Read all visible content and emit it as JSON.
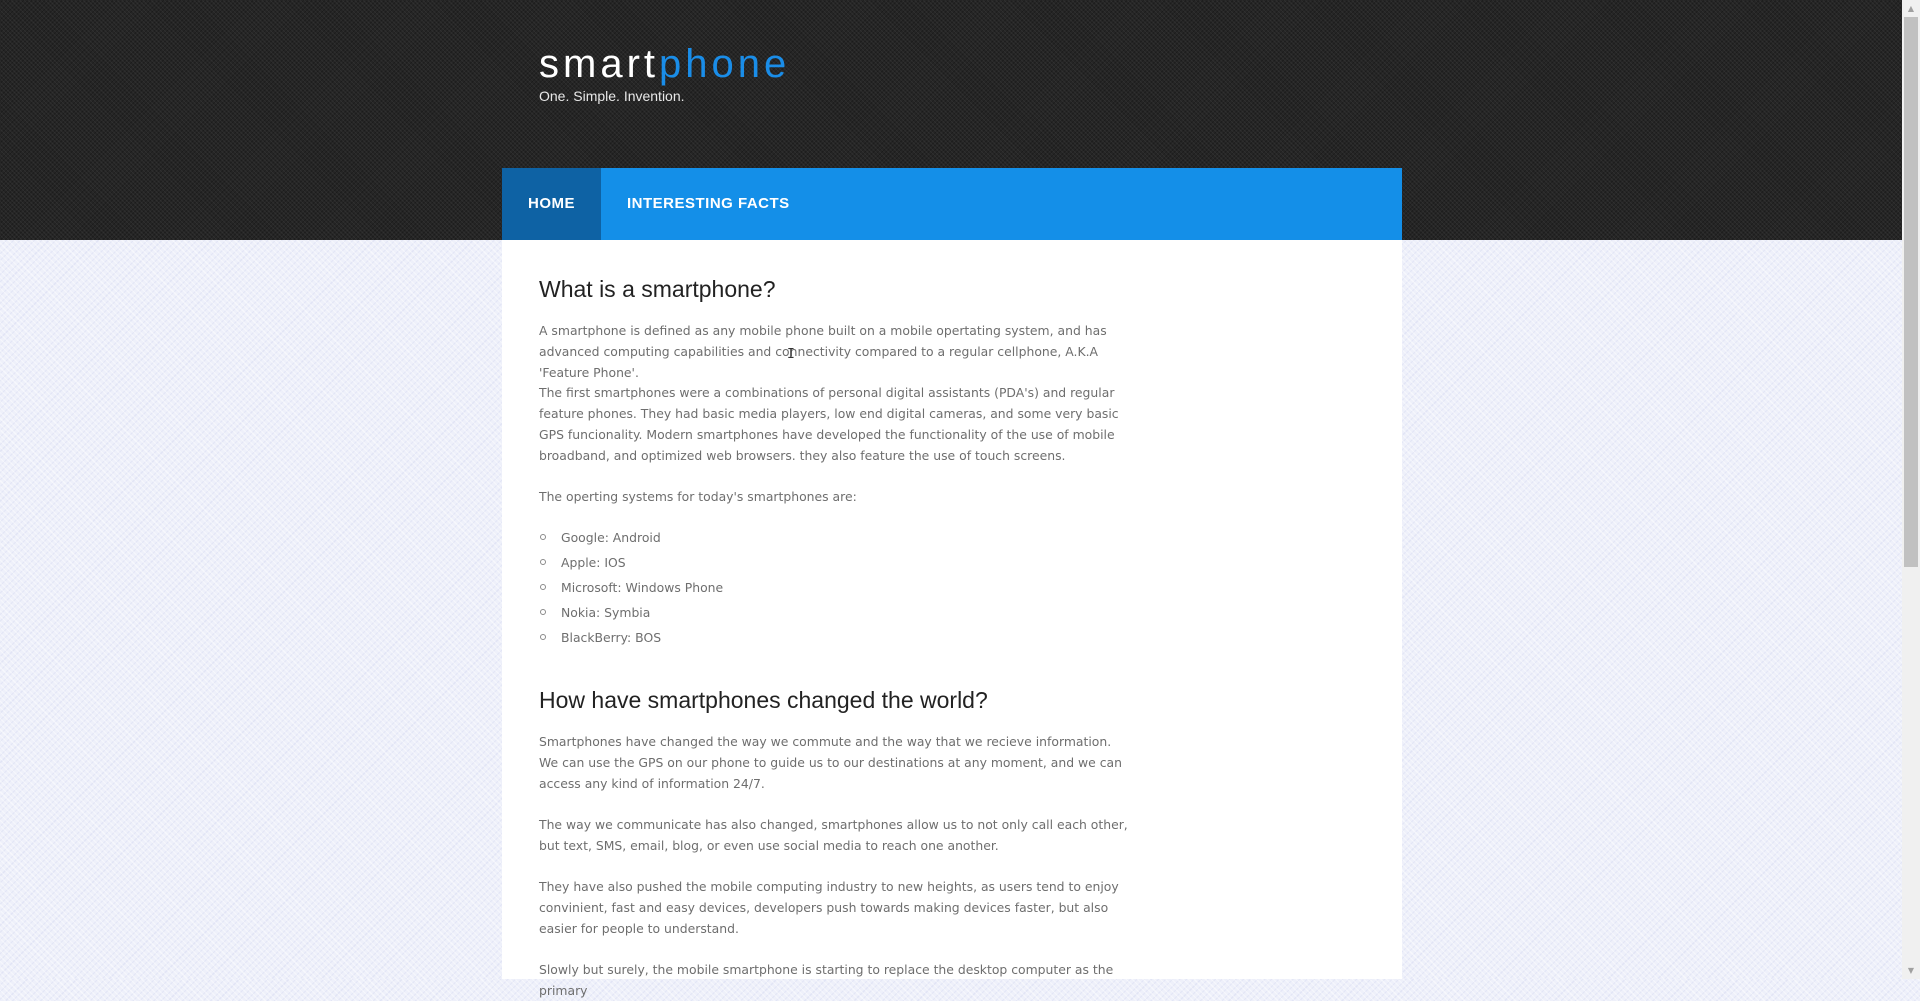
{
  "site": {
    "logo_part1": "smart",
    "logo_part2": "phone",
    "tagline": "One. Simple. Invention."
  },
  "nav": {
    "items": [
      {
        "label": "HOME",
        "active": true
      },
      {
        "label": "INTERESTING FACTS",
        "active": false
      }
    ]
  },
  "article": {
    "section1": {
      "title": "What is a smartphone?",
      "p1": "A smartphone is defined as any mobile phone built on a mobile opertating system, and has advanced computing capabilities and connectivity compared to a regular cellphone, A.K.A 'Feature Phone'.",
      "p2": "The first smartphones were a combinations of personal digital assistants (PDA's) and regular feature phones. They had basic media players, low end digital cameras, and some very basic GPS funcionality. Modern smartphones have developed the functionality of the use of mobile broadband, and optimized web browsers. they also feature the use of touch screens.",
      "p3": "The operting systems for today's smartphones are:",
      "os_list": [
        "Google: Android",
        "Apple: IOS",
        "Microsoft: Windows Phone",
        "Nokia: Symbia",
        "BlackBerry: BOS"
      ]
    },
    "section2": {
      "title": "How have smartphones changed the world?",
      "p1": "Smartphones have changed the way we commute and the way that we recieve information. We can use the GPS on our phone to guide us to our destinations at any moment, and we can access any kind of information 24/7.",
      "p2": "The way we communicate has also changed, smartphones allow us to not only call each other, but text, SMS, email, blog, or even use social media to reach one another.",
      "p3": "They have also pushed the mobile computing industry to new heights, as users tend to enjoy convinient, fast and easy devices, developers push towards making devices faster, but also easier for people to understand.",
      "p4": "Slowly but surely, the mobile smartphone is starting to replace the desktop computer as the primary"
    }
  },
  "colors": {
    "nav_bg": "#148fe8",
    "nav_active_bg": "#0e62a4",
    "logo_accent": "#1a8de8",
    "header_bg": "#252525"
  },
  "icons": {
    "cursor": "text-cursor-icon",
    "scroll_up": "scroll-up-arrow-icon",
    "scroll_down": "scroll-down-arrow-icon"
  }
}
